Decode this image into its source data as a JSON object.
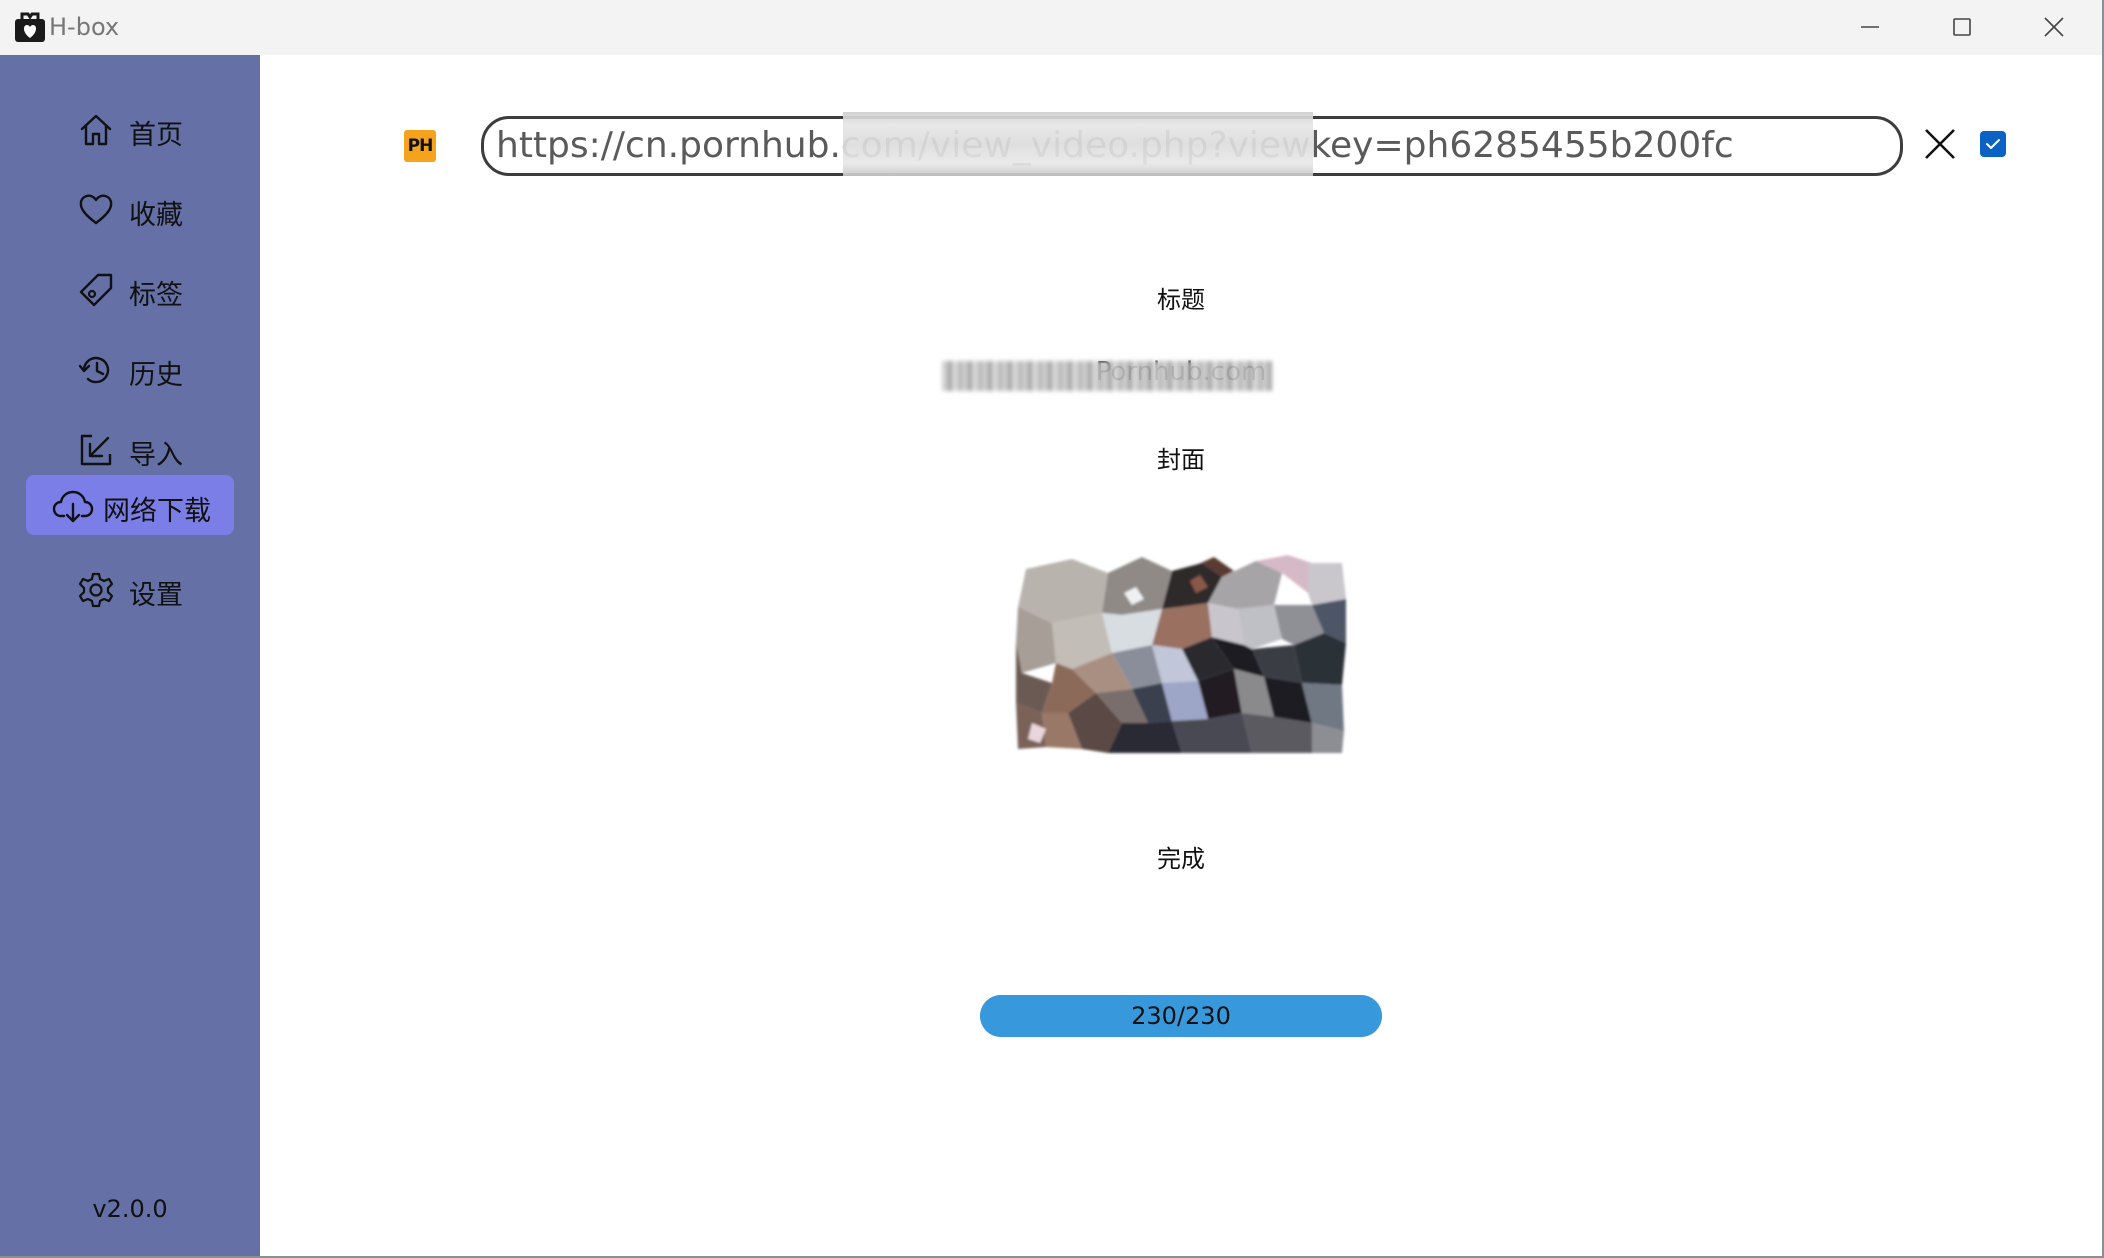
{
  "window": {
    "title": "H-box"
  },
  "sidebar": {
    "items": [
      {
        "label": "首页",
        "icon": "home-icon",
        "active": false
      },
      {
        "label": "收藏",
        "icon": "heart-icon",
        "active": false
      },
      {
        "label": "标签",
        "icon": "tag-icon",
        "active": false
      },
      {
        "label": "历史",
        "icon": "history-icon",
        "active": false
      },
      {
        "label": "导入",
        "icon": "import-icon",
        "active": false
      },
      {
        "label": "网络下载",
        "icon": "cloud-download-icon",
        "active": true
      },
      {
        "label": "设置",
        "icon": "gear-icon",
        "active": false
      }
    ],
    "version": "v2.0.0",
    "background": "#6470a6",
    "active_color": "#7b7ee6"
  },
  "download": {
    "site_logo_text": "PH",
    "url_value": "https://cn.pornhub.com/view_video.php?viewkey=ph6285455b200fc",
    "checkbox_checked": true,
    "title_label": "标题",
    "title_value": "Pornhub.com",
    "cover_label": "封面",
    "status_label": "完成",
    "progress": {
      "current": 230,
      "total": 230,
      "text": "230/230",
      "color": "#3898dc"
    }
  }
}
